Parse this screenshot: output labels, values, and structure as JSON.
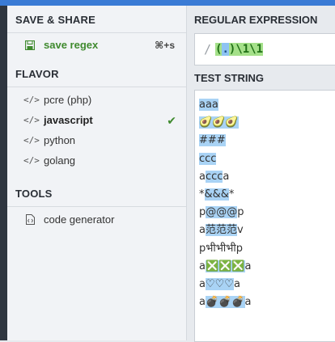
{
  "sidebar": {
    "save_title": "SAVE & SHARE",
    "save_item": {
      "label": "save regex",
      "shortcut": "⌘+s",
      "icon": "save-icon"
    },
    "flavor_title": "FLAVOR",
    "flavors": [
      {
        "label": "pcre (php)",
        "active": false
      },
      {
        "label": "javascript",
        "active": true
      },
      {
        "label": "python",
        "active": false
      },
      {
        "label": "golang",
        "active": false
      }
    ],
    "flavor_icon_glyph": "</>",
    "check_glyph": "✔",
    "tools_title": "TOOLS",
    "tools": [
      {
        "label": "code generator",
        "icon": "code-file-icon"
      }
    ]
  },
  "main": {
    "regex_title": "REGULAR EXPRESSION",
    "regex_delimiter": "/",
    "regex_tokens": [
      {
        "text": "(",
        "kind": "group"
      },
      {
        "text": ".",
        "kind": "dot"
      },
      {
        "text": ")",
        "kind": "group"
      },
      {
        "text": "\\1\\1",
        "kind": "ref"
      }
    ],
    "test_title": "TEST STRING",
    "test_lines": [
      "aaa",
      "🥑🥑🥑",
      "###",
      "ccc",
      "accca",
      "*&&&*",
      "p@@@p",
      "a范范范v",
      "pभीभीभीp",
      "a❎❎❎a",
      "a♡♡♡a",
      "a💣💣💣a"
    ]
  },
  "colors": {
    "accent": "#3a7bd5",
    "save_green": "#3f8a2e",
    "match_highlight": "#a9d3f5",
    "group_green": "#a4e089",
    "dot_blue": "#8ec3f2"
  }
}
